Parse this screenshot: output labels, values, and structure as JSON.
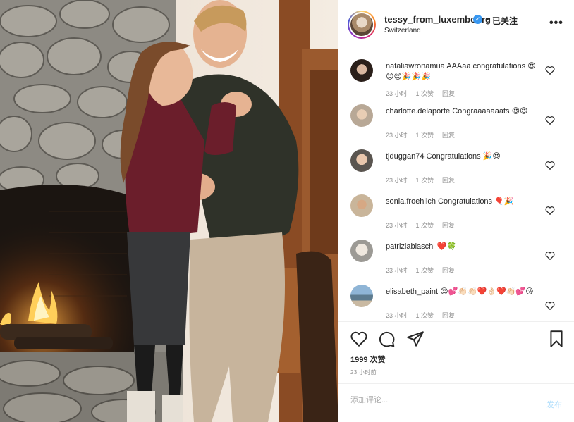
{
  "post": {
    "header": {
      "username": "tessy_from_luxembourg",
      "verified_icon": "✓",
      "separator": "•",
      "follow_label": "已关注",
      "location": "Switzerland",
      "more_icon": "•••"
    },
    "comments": [
      {
        "username": "nataliawronamua",
        "text": "AAAaa congratulations 😍😍😍🎉🎉🎉",
        "time": "23 小时",
        "likes": "1 次赞",
        "reply": "回复"
      },
      {
        "username": "charlotte.delaporte",
        "text": "Congraaaaaaats 😍😍",
        "time": "23 小时",
        "likes": "1 次赞",
        "reply": "回复"
      },
      {
        "username": "tjduggan74",
        "text": "Congratulations 🎉😍",
        "time": "23 小时",
        "likes": "1 次赞",
        "reply": "回复"
      },
      {
        "username": "sonia.froehlich",
        "text": "Congratulations 🎈🎉",
        "time": "23 小时",
        "likes": "1 次赞",
        "reply": "回复"
      },
      {
        "username": "patriziablaschi",
        "text": "❤️🍀",
        "time": "23 小时",
        "likes": "1 次赞",
        "reply": "回复"
      },
      {
        "username": "elisabeth_paint",
        "text": "😍💕👏🏻👏🏻❤️👌🏻❤️👏🏻💕😘",
        "time": "23 小时",
        "likes": "1 次赞",
        "reply": "回复"
      }
    ],
    "likes_label": "1999 次赞",
    "time_ago": "23 小时前",
    "comment_box": {
      "placeholder": "添加评论...",
      "post_label": "发布"
    }
  },
  "colors": {
    "accent": "#3897f0",
    "post_button_disabled": "#b2dffc",
    "muted_text": "#8e8e8e",
    "text": "#262626"
  }
}
